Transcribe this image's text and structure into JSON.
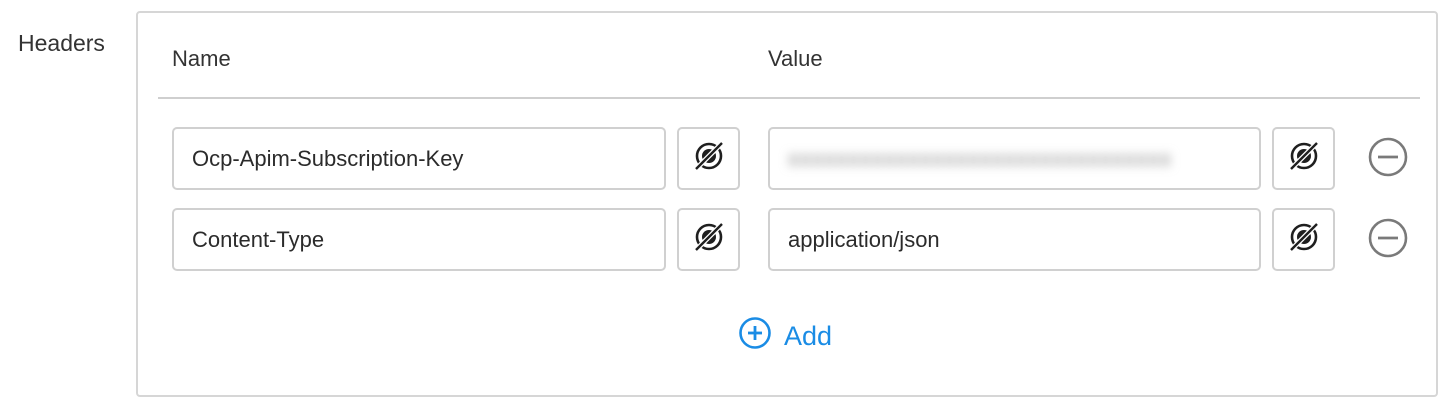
{
  "section": {
    "label": "Headers"
  },
  "columns": {
    "name": "Name",
    "value": "Value"
  },
  "rows": [
    {
      "name": "Ocp-Apim-Subscription-Key",
      "value": "xxxxxxxxxxxxxxxxxxxxxxxxxxxxxxxx",
      "value_obscured": true
    },
    {
      "name": "Content-Type",
      "value": "application/json",
      "value_obscured": false
    }
  ],
  "icons": {
    "variable": "variable-insert-icon",
    "remove": "minus-circle-icon",
    "add": "plus-circle-icon"
  },
  "add_button": {
    "label": "Add"
  },
  "colors": {
    "accent": "#1a8ce5",
    "border": "#d0d0d0",
    "text": "#333333",
    "remove_icon": "#7a7a7a"
  }
}
